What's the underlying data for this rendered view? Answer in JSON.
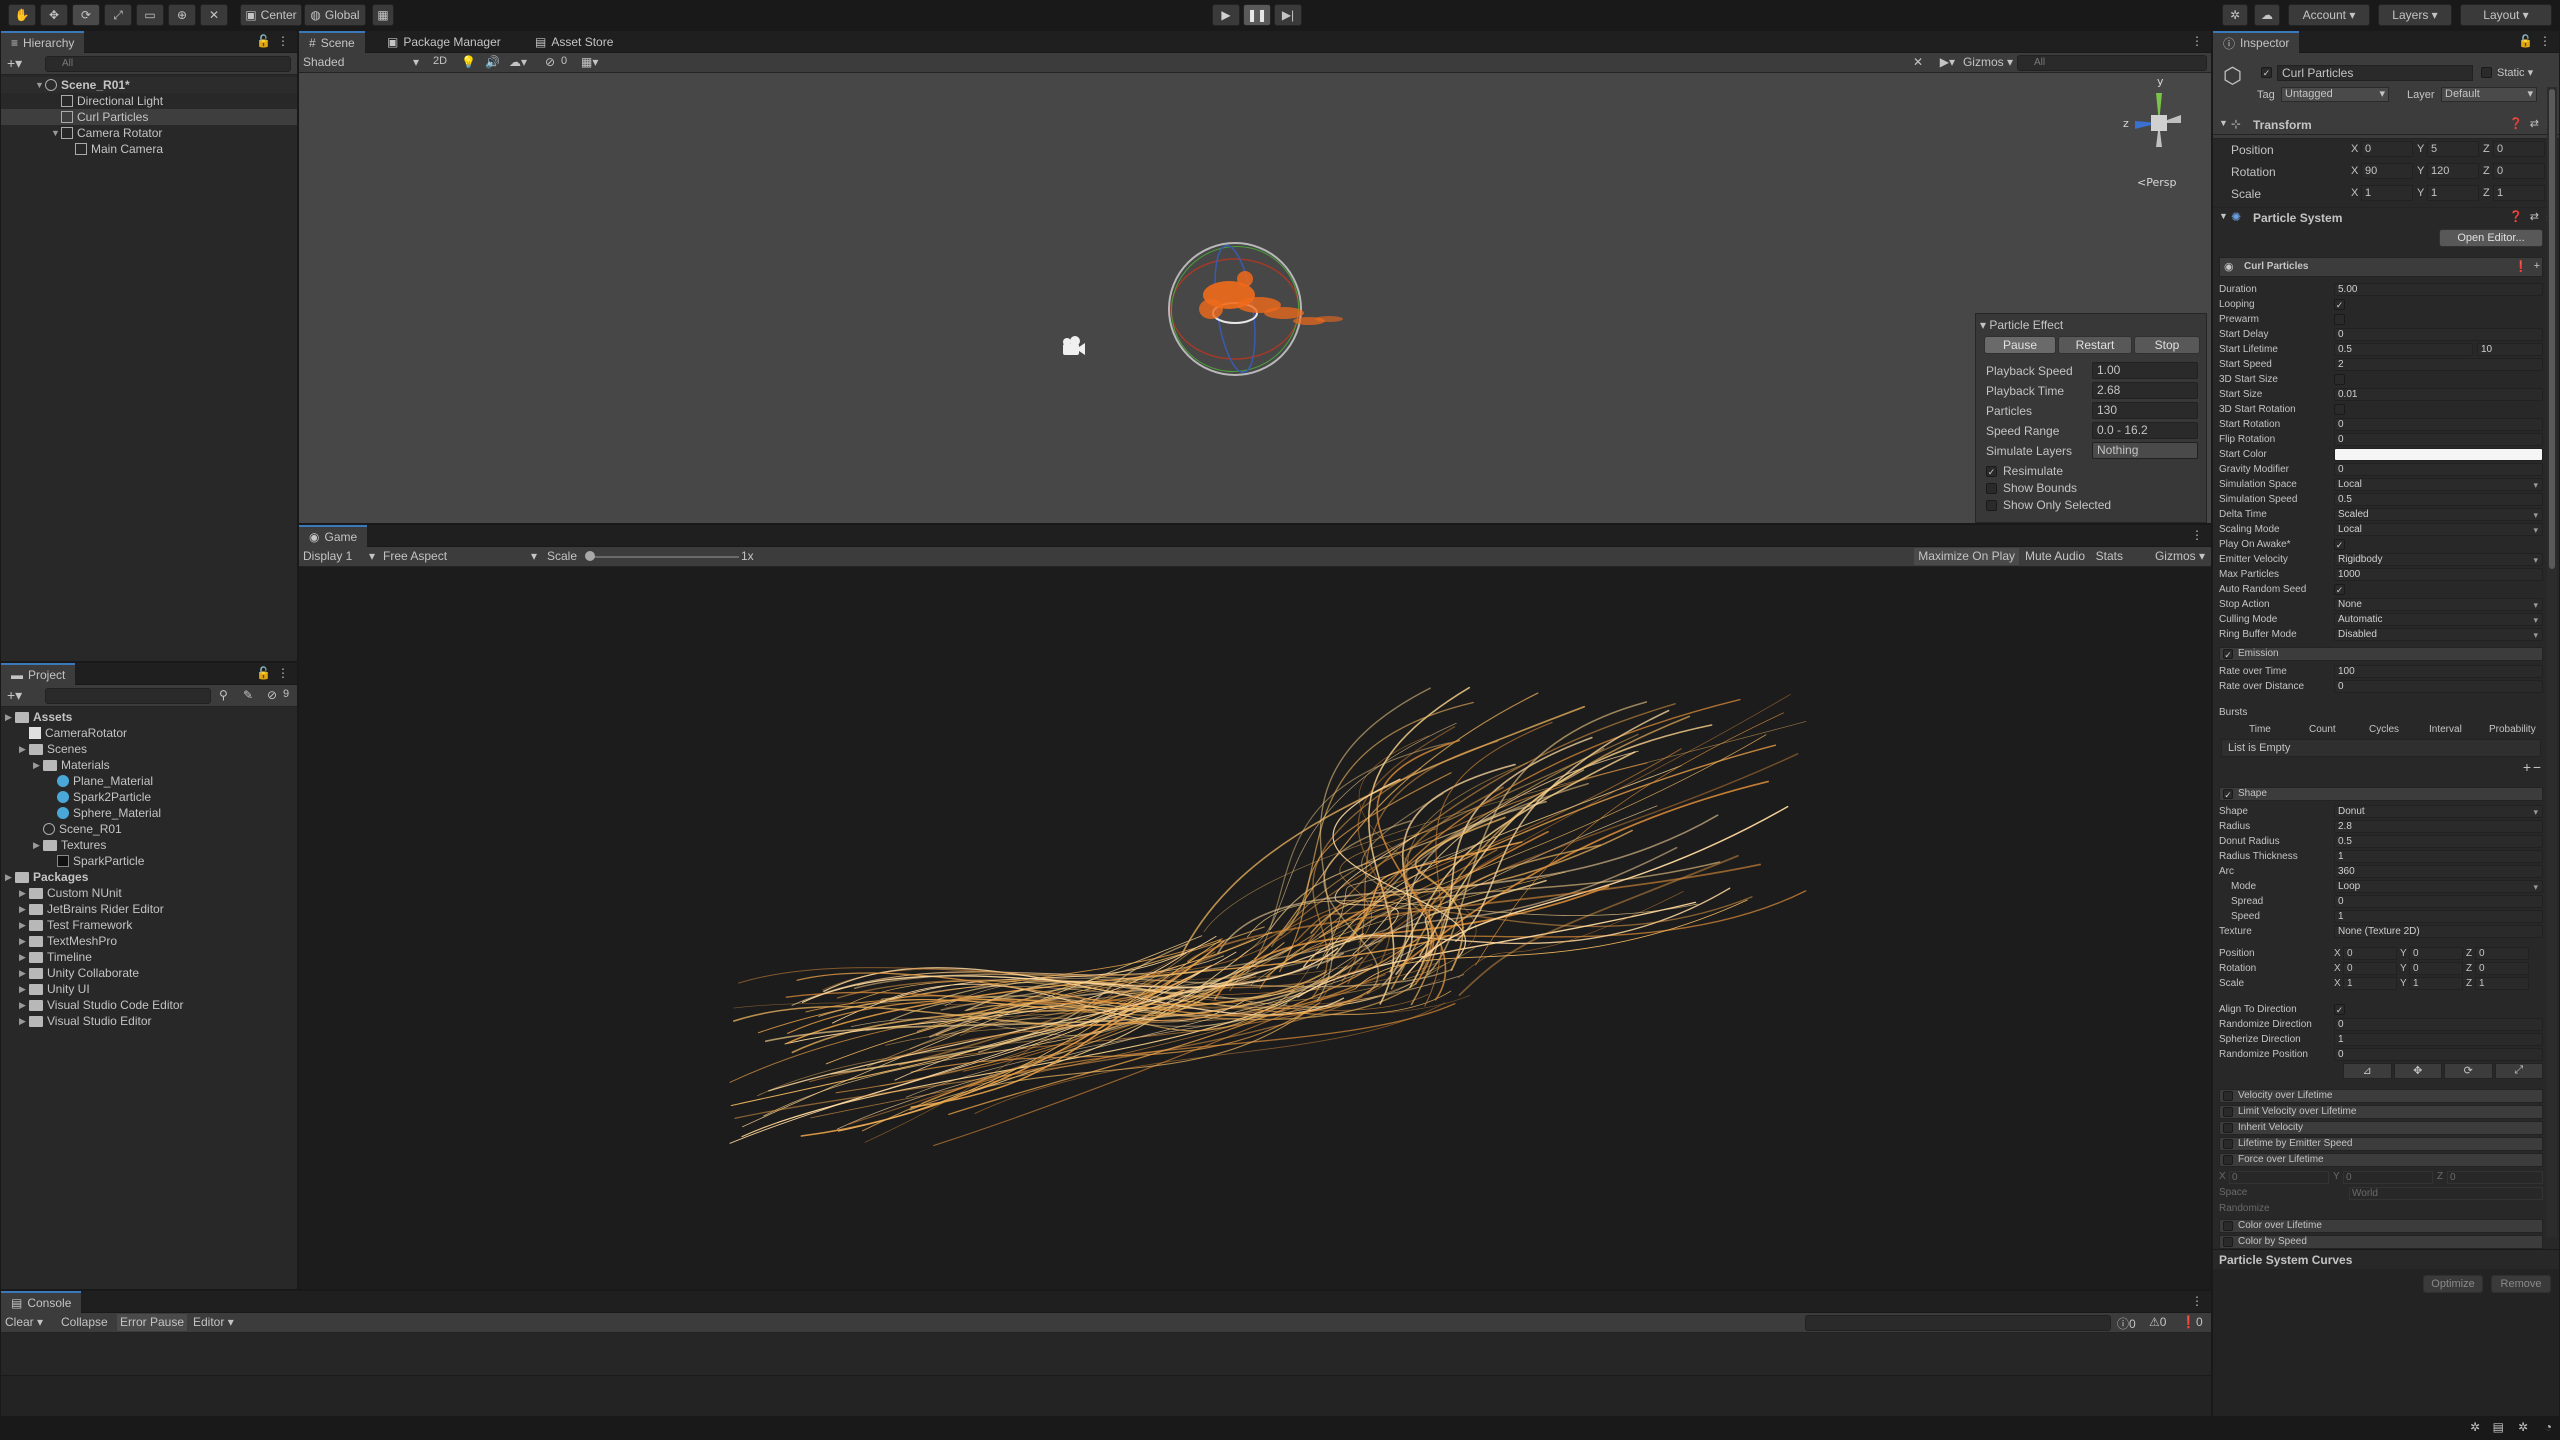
{
  "toolbar": {
    "center_label": "Center",
    "global_label": "Global",
    "account_label": "Account",
    "layers_label": "Layers",
    "layout_label": "Layout"
  },
  "hierarchy": {
    "tab": "Hierarchy",
    "search_placeholder": "All",
    "scene": "Scene_R01*",
    "items": [
      "Directional Light",
      "Curl Particles",
      "Camera Rotator",
      "Main Camera"
    ]
  },
  "scene_view": {
    "tabs": [
      "Scene",
      "Package Manager",
      "Asset Store"
    ],
    "shading": "Shaded",
    "mode_2d": "2D",
    "gizmos_label": "Gizmos",
    "search_placeholder": "All",
    "hidden_count": "0",
    "persp_label": "Persp",
    "gizmo_y": "y",
    "gizmo_z": "z"
  },
  "particle_effect": {
    "title": "Particle Effect",
    "pause": "Pause",
    "restart": "Restart",
    "stop": "Stop",
    "rows": [
      {
        "label": "Playback Speed",
        "value": "1.00"
      },
      {
        "label": "Playback Time",
        "value": "2.68"
      },
      {
        "label": "Particles",
        "value": "130"
      },
      {
        "label": "Speed Range",
        "value": "0.0 - 16.2"
      },
      {
        "label": "Simulate Layers",
        "value": "Nothing"
      }
    ],
    "checks": [
      {
        "label": "Resimulate",
        "checked": true
      },
      {
        "label": "Show Bounds",
        "checked": false
      },
      {
        "label": "Show Only Selected",
        "checked": false
      }
    ]
  },
  "game_view": {
    "tab": "Game",
    "display": "Display 1",
    "aspect": "Free Aspect",
    "scale_label": "Scale",
    "scale_value": "1x",
    "buttons": [
      "Maximize On Play",
      "Mute Audio",
      "Stats",
      "Gizmos"
    ]
  },
  "project": {
    "tab": "Project",
    "hidden_count": "9",
    "tree": [
      {
        "label": "Assets",
        "depth": 0,
        "kind": "folder",
        "bold": true
      },
      {
        "label": "CameraRotator",
        "depth": 1,
        "kind": "script"
      },
      {
        "label": "Scenes",
        "depth": 1,
        "kind": "folder"
      },
      {
        "label": "Materials",
        "depth": 2,
        "kind": "folder"
      },
      {
        "label": "Plane_Material",
        "depth": 3,
        "kind": "material"
      },
      {
        "label": "Spark2Particle",
        "depth": 3,
        "kind": "material"
      },
      {
        "label": "Sphere_Material",
        "depth": 3,
        "kind": "material"
      },
      {
        "label": "Scene_R01",
        "depth": 2,
        "kind": "scene"
      },
      {
        "label": "Textures",
        "depth": 2,
        "kind": "folder"
      },
      {
        "label": "SparkParticle",
        "depth": 3,
        "kind": "texture"
      },
      {
        "label": "Packages",
        "depth": 0,
        "kind": "folder",
        "bold": true
      },
      {
        "label": "Custom NUnit",
        "depth": 1,
        "kind": "folder"
      },
      {
        "label": "JetBrains Rider Editor",
        "depth": 1,
        "kind": "folder"
      },
      {
        "label": "Test Framework",
        "depth": 1,
        "kind": "folder"
      },
      {
        "label": "TextMeshPro",
        "depth": 1,
        "kind": "folder"
      },
      {
        "label": "Timeline",
        "depth": 1,
        "kind": "folder"
      },
      {
        "label": "Unity Collaborate",
        "depth": 1,
        "kind": "folder"
      },
      {
        "label": "Unity UI",
        "depth": 1,
        "kind": "folder"
      },
      {
        "label": "Visual Studio Code Editor",
        "depth": 1,
        "kind": "folder"
      },
      {
        "label": "Visual Studio Editor",
        "depth": 1,
        "kind": "folder"
      }
    ]
  },
  "console": {
    "tab": "Console",
    "clear": "Clear",
    "collapse": "Collapse",
    "error_pause": "Error Pause",
    "editor": "Editor",
    "log_count": "0",
    "warn_count": "0",
    "error_count": "0"
  },
  "inspector": {
    "tab": "Inspector",
    "object_name": "Curl Particles",
    "static_label": "Static",
    "tag_label": "Tag",
    "tag_value": "Untagged",
    "layer_label": "Layer",
    "layer_value": "Default",
    "transform": {
      "title": "Transform",
      "rows": [
        {
          "label": "Position",
          "x": "0",
          "y": "5",
          "z": "0"
        },
        {
          "label": "Rotation",
          "x": "90",
          "y": "120",
          "z": "0"
        },
        {
          "label": "Scale",
          "x": "1",
          "y": "1",
          "z": "1"
        }
      ]
    },
    "particle_system": {
      "title": "Particle System",
      "open_editor": "Open Editor...",
      "system_name": "Curl Particles",
      "main_rows": [
        {
          "label": "Duration",
          "value": "5.00"
        },
        {
          "label": "Looping",
          "value": "✓"
        },
        {
          "label": "Prewarm",
          "value": ""
        },
        {
          "label": "Start Delay",
          "value": "0"
        },
        {
          "label": "Start Lifetime",
          "value": "0.5",
          "value2": "10"
        },
        {
          "label": "Start Speed",
          "value": "2"
        },
        {
          "label": "3D Start Size",
          "value": ""
        },
        {
          "label": "Start Size",
          "value": "0.01"
        },
        {
          "label": "3D Start Rotation",
          "value": ""
        },
        {
          "label": "Start Rotation",
          "value": "0"
        },
        {
          "label": "Flip Rotation",
          "value": "0"
        },
        {
          "label": "Start Color",
          "value": ""
        },
        {
          "label": "Gravity Modifier",
          "value": "0"
        },
        {
          "label": "Simulation Space",
          "value": "Local"
        },
        {
          "label": "Simulation Speed",
          "value": "0.5"
        },
        {
          "label": "Delta Time",
          "value": "Scaled"
        },
        {
          "label": "Scaling Mode",
          "value": "Local"
        },
        {
          "label": "Play On Awake*",
          "value": "✓"
        },
        {
          "label": "Emitter Velocity",
          "value": "Rigidbody"
        },
        {
          "label": "Max Particles",
          "value": "1000"
        },
        {
          "label": "Auto Random Seed",
          "value": "✓"
        },
        {
          "label": "Stop Action",
          "value": "None"
        },
        {
          "label": "Culling Mode",
          "value": "Automatic"
        },
        {
          "label": "Ring Buffer Mode",
          "value": "Disabled"
        }
      ],
      "emission": {
        "title": "Emission",
        "rows": [
          {
            "label": "Rate over Time",
            "value": "100"
          },
          {
            "label": "Rate over Distance",
            "value": "0"
          }
        ],
        "bursts_label": "Bursts",
        "burst_cols": [
          "Time",
          "Count",
          "Cycles",
          "Interval",
          "Probability"
        ],
        "empty": "List is Empty"
      },
      "shape": {
        "title": "Shape",
        "rows": [
          {
            "label": "Shape",
            "value": "Donut"
          },
          {
            "label": "Radius",
            "value": "2.8"
          },
          {
            "label": "Donut Radius",
            "value": "0.5"
          },
          {
            "label": "Radius Thickness",
            "value": "1"
          },
          {
            "label": "Arc",
            "value": "360"
          },
          {
            "label": "Mode",
            "value": "Loop"
          },
          {
            "label": "Spread",
            "value": "0"
          },
          {
            "label": "Speed",
            "value": "1"
          },
          {
            "label": "Texture",
            "value": "None (Texture 2D)"
          }
        ],
        "xyz_rows": [
          {
            "label": "Position",
            "x": "0",
            "y": "0",
            "z": "0"
          },
          {
            "label": "Rotation",
            "x": "0",
            "y": "0",
            "z": "0"
          },
          {
            "label": "Scale",
            "x": "1",
            "y": "1",
            "z": "1"
          }
        ],
        "more_rows": [
          {
            "label": "Align To Direction",
            "value": "✓"
          },
          {
            "label": "Randomize Direction",
            "value": "0"
          },
          {
            "label": "Spherize Direction",
            "value": "1"
          },
          {
            "label": "Randomize Position",
            "value": "0"
          }
        ]
      },
      "modules": [
        "Velocity over Lifetime",
        "Limit Velocity over Lifetime",
        "Inherit Velocity",
        "Lifetime by Emitter Speed",
        "Force over Lifetime"
      ],
      "force_x": "0",
      "force_y": "0",
      "force_z": "0",
      "space_label": "Space",
      "space_value": "World",
      "randomize_label": "Randomize",
      "modules2": [
        "Color over Lifetime",
        "Color by Speed"
      ],
      "curves_title": "Particle System Curves",
      "optimize": "Optimize",
      "remove": "Remove"
    }
  }
}
